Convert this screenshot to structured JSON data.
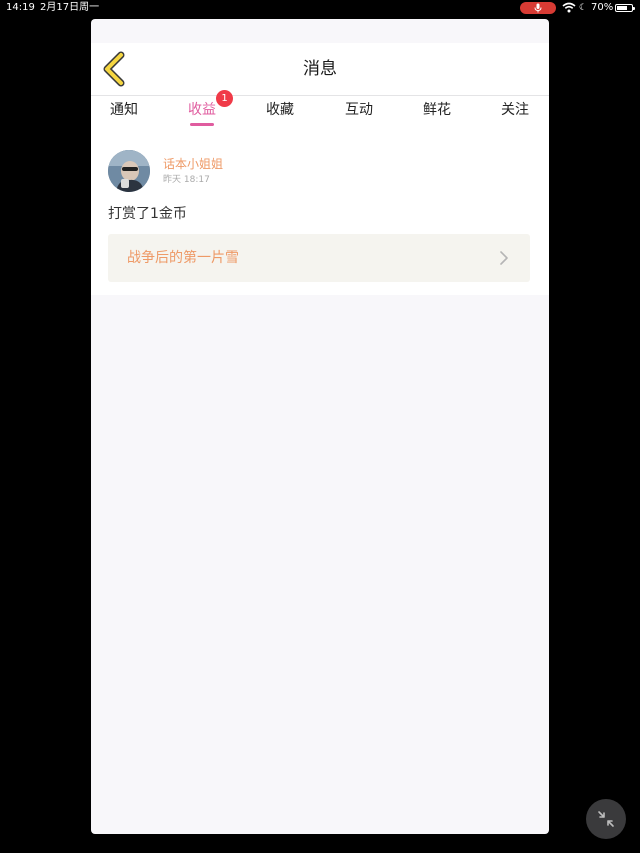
{
  "status_bar": {
    "time": "14:19",
    "date": "2月17日周一",
    "battery_text": "70%",
    "battery_level": 0.7,
    "mic_icon": "mic-icon",
    "wifi_icon": "wifi-icon",
    "moon_icon": "moon-icon",
    "recording_color": "#d73b34"
  },
  "nav": {
    "title": "消息",
    "back_icon": "chevron-left-icon"
  },
  "tabs": [
    {
      "label": "通知",
      "active": false
    },
    {
      "label": "收益",
      "active": true,
      "badge": "1"
    },
    {
      "label": "收藏",
      "active": false
    },
    {
      "label": "互动",
      "active": false
    },
    {
      "label": "鲜花",
      "active": false
    },
    {
      "label": "关注",
      "active": false
    }
  ],
  "message": {
    "user_name": "话本小姐姐",
    "time": "昨天 18:17",
    "text": "打赏了1金币",
    "work_title": "战争后的第一片雪",
    "link_icon": "chevron-right-icon"
  },
  "colors": {
    "accent": "#e05c9f",
    "badge": "#f03a48",
    "username": "#ee9a67",
    "back_arrow": "#f5d641"
  },
  "floating_button_icon": "collapse-icon"
}
